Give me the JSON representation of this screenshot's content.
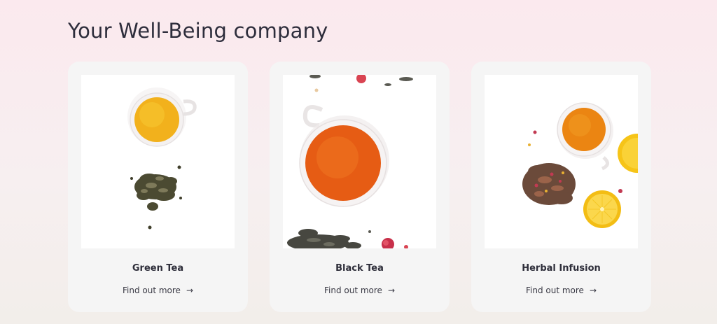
{
  "header": {
    "title": "Your Well-Being company"
  },
  "cards": [
    {
      "name": "Green Tea",
      "link_label": "Find out more",
      "link_icon": "arrow-right-icon",
      "image": "green-tea-cup-and-loose-leaves"
    },
    {
      "name": "Black Tea",
      "link_label": "Find out more",
      "link_icon": "arrow-right-icon",
      "image": "black-tea-cup-and-loose-leaves"
    },
    {
      "name": "Herbal Infusion",
      "link_label": "Find out more",
      "link_icon": "arrow-right-icon",
      "image": "herbal-infusion-cup-lemon-and-leaves"
    }
  ],
  "colors": {
    "background_top": "#fbe9ee",
    "background_bottom": "#f2eeea",
    "card": "#f5f5f5",
    "text": "#2e2e3a"
  }
}
